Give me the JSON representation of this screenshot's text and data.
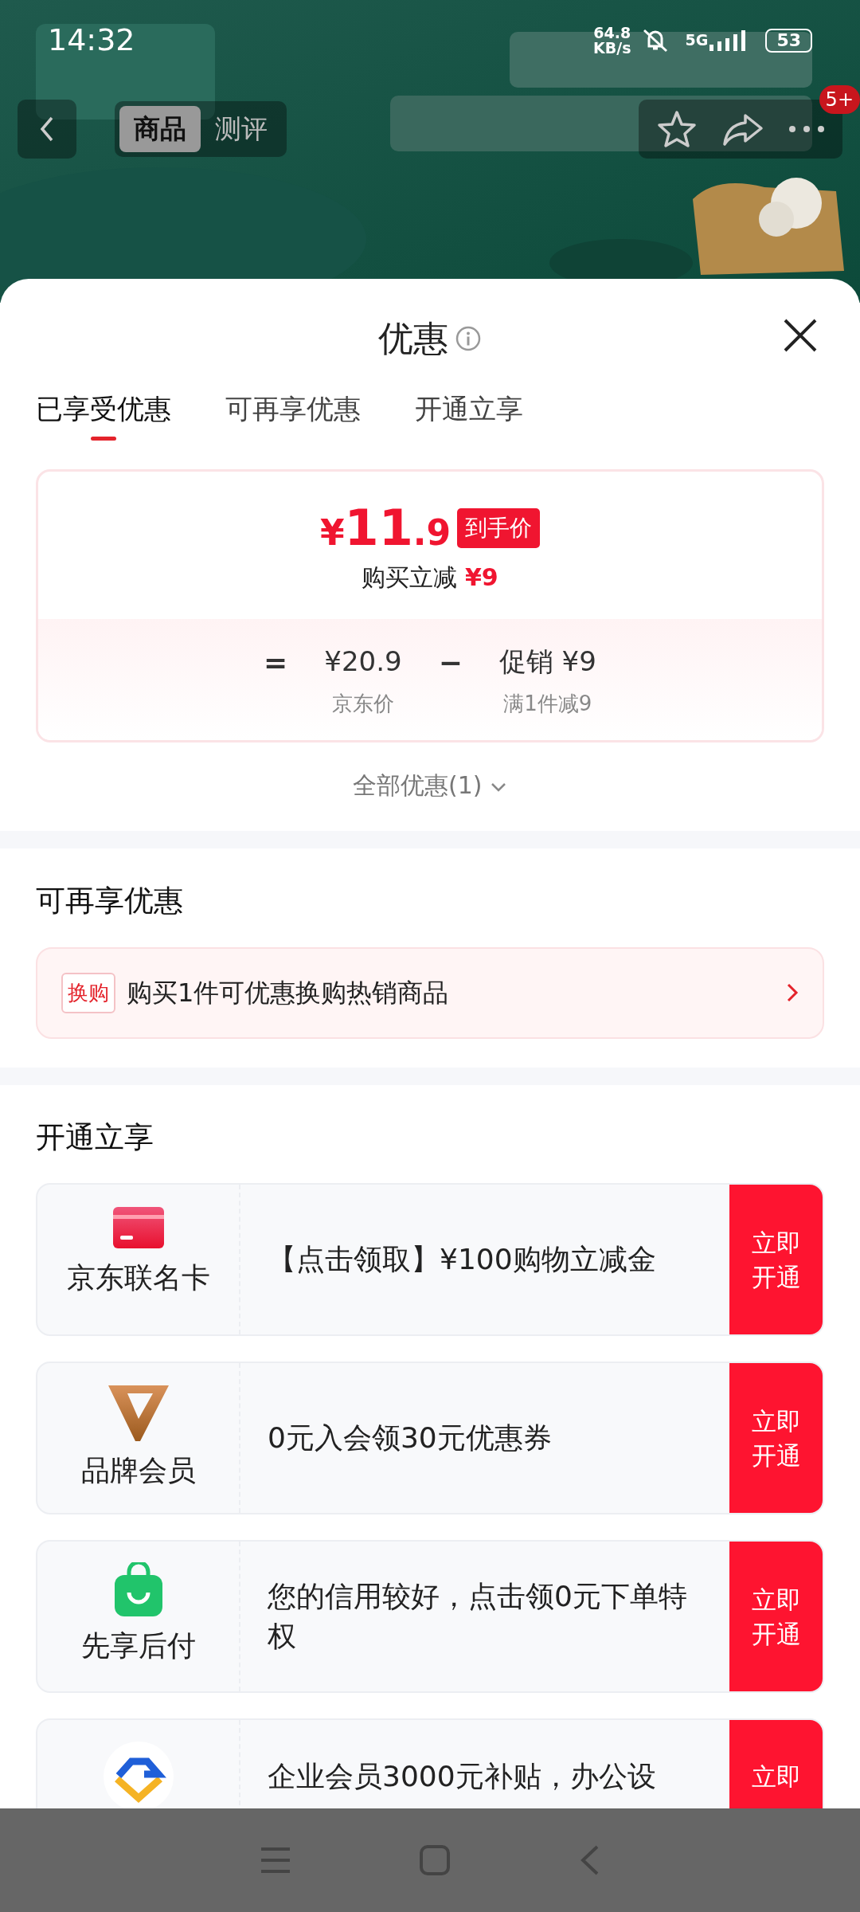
{
  "status_bar": {
    "time": "14:32",
    "net_speed": "64.8",
    "net_unit": "KB/s",
    "network": "5G",
    "battery": "53"
  },
  "header": {
    "tabs": [
      {
        "label": "商品",
        "selected": true
      },
      {
        "label": "测评",
        "selected": false
      }
    ],
    "badge": "5+"
  },
  "sheet": {
    "title": "优惠",
    "tabs": [
      {
        "label": "已享受优惠",
        "selected": true
      },
      {
        "label": "可再享优惠",
        "selected": false
      },
      {
        "label": "开通立享",
        "selected": false
      }
    ],
    "price_card": {
      "currency": "¥",
      "price_int": "11",
      "price_dec": ".9",
      "price_tag": "到手价",
      "saving_label": "购买立减",
      "saving": "¥9",
      "formula": [
        {
          "kind": "operator",
          "text": "="
        },
        {
          "kind": "term",
          "value": "¥20.9",
          "caption": "京东价"
        },
        {
          "kind": "operator",
          "text": "−"
        },
        {
          "kind": "term",
          "value": "促销 ¥9",
          "caption": "满1件减9"
        }
      ]
    },
    "all_offers": "全部优惠(1)"
  },
  "more_offers": {
    "heading": "可再享优惠",
    "items": [
      {
        "tag": "换购",
        "text": "购买1件可优惠换购热销商品"
      }
    ]
  },
  "open_now": {
    "heading": "开通立享",
    "items": [
      {
        "name": "京东联名卡",
        "text": "【点击领取】¥100购物立减金",
        "action": "立即开通"
      },
      {
        "name": "品牌会员",
        "text": "0元入会领30元优惠券",
        "action": "立即开通"
      },
      {
        "name": "先享后付",
        "text": "您的信用较好，点击领0元下单特权",
        "action": "立即开通"
      },
      {
        "text": "企业会员3000元补贴，办公设",
        "action": "立即"
      }
    ]
  }
}
